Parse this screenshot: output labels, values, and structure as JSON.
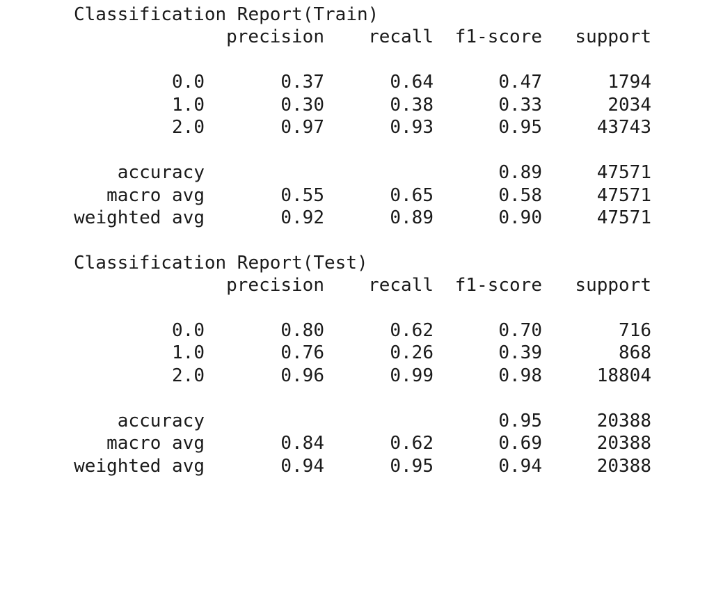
{
  "reports": [
    {
      "title": "Classification Report(Train)",
      "headers": {
        "precision": "precision",
        "recall": "recall",
        "f1": "f1-score",
        "support": "support"
      },
      "classes": [
        {
          "label": "0.0",
          "precision": "0.37",
          "recall": "0.64",
          "f1": "0.47",
          "support": "1794"
        },
        {
          "label": "1.0",
          "precision": "0.30",
          "recall": "0.38",
          "f1": "0.33",
          "support": "2034"
        },
        {
          "label": "2.0",
          "precision": "0.97",
          "recall": "0.93",
          "f1": "0.95",
          "support": "43743"
        }
      ],
      "summary": [
        {
          "label": "accuracy",
          "precision": "",
          "recall": "",
          "f1": "0.89",
          "support": "47571"
        },
        {
          "label": "macro avg",
          "precision": "0.55",
          "recall": "0.65",
          "f1": "0.58",
          "support": "47571"
        },
        {
          "label": "weighted avg",
          "precision": "0.92",
          "recall": "0.89",
          "f1": "0.90",
          "support": "47571"
        }
      ]
    },
    {
      "title": "Classification Report(Test)",
      "headers": {
        "precision": "precision",
        "recall": "recall",
        "f1": "f1-score",
        "support": "support"
      },
      "classes": [
        {
          "label": "0.0",
          "precision": "0.80",
          "recall": "0.62",
          "f1": "0.70",
          "support": "716"
        },
        {
          "label": "1.0",
          "precision": "0.76",
          "recall": "0.26",
          "f1": "0.39",
          "support": "868"
        },
        {
          "label": "2.0",
          "precision": "0.96",
          "recall": "0.99",
          "f1": "0.98",
          "support": "18804"
        }
      ],
      "summary": [
        {
          "label": "accuracy",
          "precision": "",
          "recall": "",
          "f1": "0.95",
          "support": "20388"
        },
        {
          "label": "macro avg",
          "precision": "0.84",
          "recall": "0.62",
          "f1": "0.69",
          "support": "20388"
        },
        {
          "label": "weighted avg",
          "precision": "0.94",
          "recall": "0.95",
          "f1": "0.94",
          "support": "20388"
        }
      ]
    }
  ]
}
